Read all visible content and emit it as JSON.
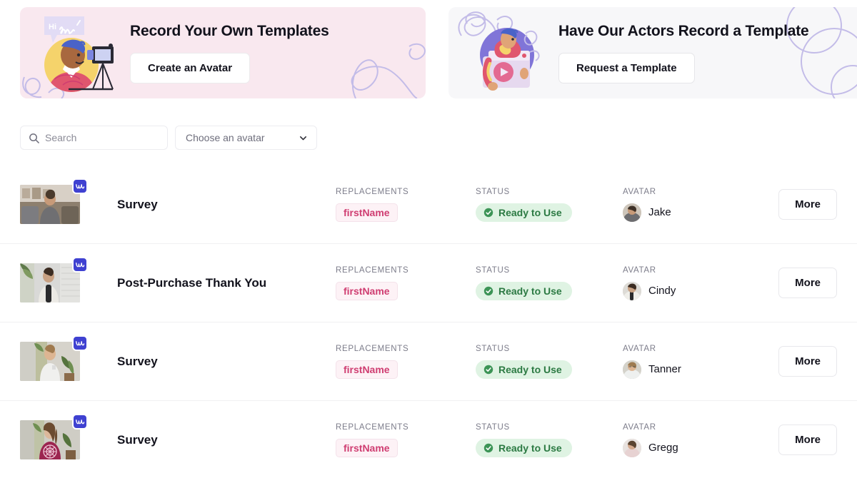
{
  "banners": [
    {
      "title": "Record Your Own Templates",
      "button_label": "Create an Avatar",
      "illustration": "person-with-camera-illustration",
      "bg_color": "#f9e8ef",
      "deco_color": "#c3bce8"
    },
    {
      "title": "Have Our Actors Record a Template",
      "button_label": "Request a Template",
      "illustration": "person-holding-video-player-illustration",
      "bg_color": "#f7f7f9",
      "deco_color": "#c3bce8"
    }
  ],
  "filters": {
    "search": {
      "placeholder": "Search",
      "value": "",
      "icon": "search-icon"
    },
    "avatar_select": {
      "selected_label": "Choose an avatar",
      "icon": "chevron-down-icon"
    }
  },
  "table": {
    "columns": {
      "replacements": "REPLACEMENTS",
      "status": "STATUS",
      "avatar": "AVATAR"
    },
    "more_label": "More",
    "badge_icon": "wistia-w-logo-icon",
    "status_icon": "check-circle-icon",
    "status_color": "#2c7a43",
    "status_bg": "#dff3e3",
    "tag_color": "#cf3d71",
    "rows": [
      {
        "title": "Survey",
        "replacement": "firstName",
        "status": "Ready to Use",
        "avatar_name": "Jake",
        "thumb_desc": "man-seated-in-living-room-thumbnail"
      },
      {
        "title": "Post-Purchase Thank You",
        "replacement": "firstName",
        "status": "Ready to Use",
        "avatar_name": "Cindy",
        "thumb_desc": "woman-in-white-tank-top-thumbnail"
      },
      {
        "title": "Survey",
        "replacement": "firstName",
        "status": "Ready to Use",
        "avatar_name": "Tanner",
        "thumb_desc": "man-in-white-shirt-with-plants-thumbnail"
      },
      {
        "title": "Survey",
        "replacement": "firstName",
        "status": "Ready to Use",
        "avatar_name": "Gregg",
        "thumb_desc": "person-in-maroon-shirt-thumbnail"
      }
    ]
  }
}
